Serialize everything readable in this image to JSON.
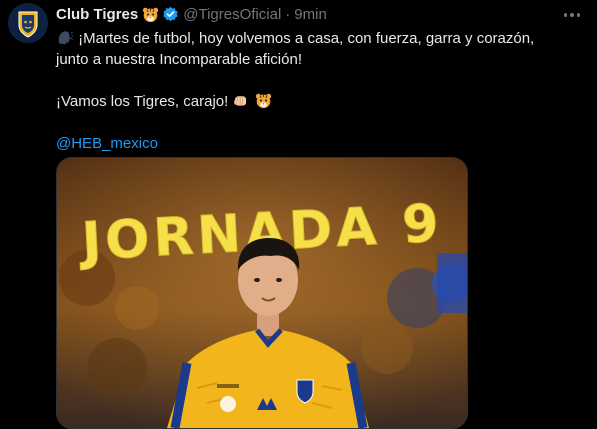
{
  "tweet": {
    "display_name": "Club Tigres",
    "handle": "@TigresOficial",
    "separator": "·",
    "time": "9min",
    "line1": "¡Martes de futbol, hoy volvemos a casa, con fuerza, garra y corazón,",
    "line2": "junto a nuestra Incomparable afición!",
    "line3": "¡Vamos los Tigres, carajo!",
    "mention": "@HEB_mexico"
  },
  "media": {
    "headline": "JORNADA 9"
  },
  "colors": {
    "accent": "#1d9bf0",
    "text": "#e7e9ea",
    "muted": "#71767b",
    "jersey": "#f2b51c",
    "headline": "#f6e04a"
  },
  "icons": {
    "avatar": "tigres-crest",
    "verified": "verified-badge-icon",
    "more": "more-options-icon",
    "emoji_speaker": "speaking-head-emoji",
    "emoji_tiger": "tiger-face-emoji",
    "emoji_fist": "oncoming-fist-emoji"
  }
}
